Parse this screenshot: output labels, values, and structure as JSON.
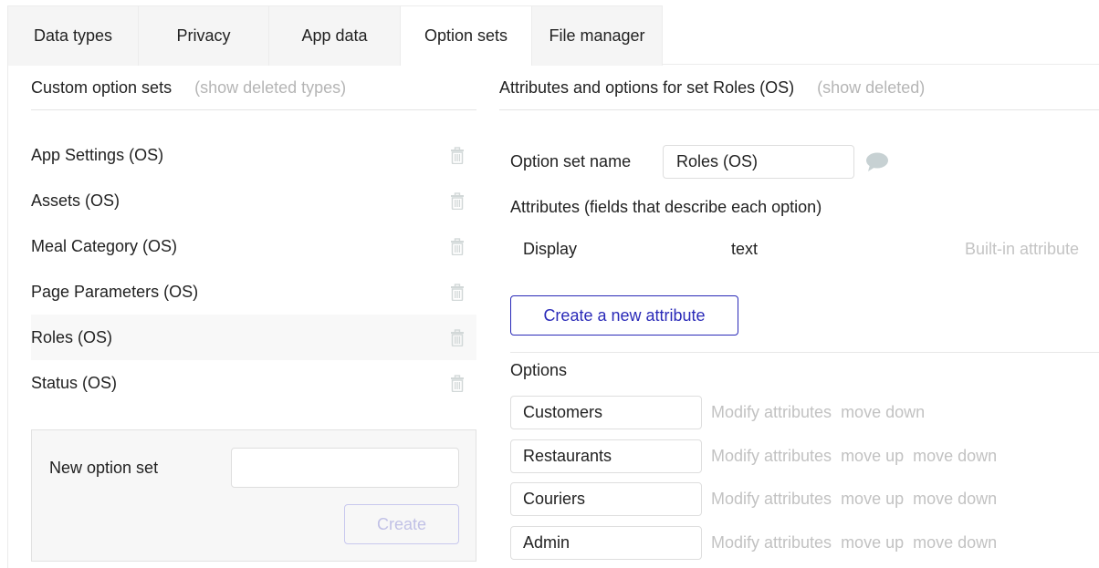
{
  "tabs": [
    {
      "label": "Data types",
      "active": false
    },
    {
      "label": "Privacy",
      "active": false
    },
    {
      "label": "App data",
      "active": false
    },
    {
      "label": "Option sets",
      "active": true
    },
    {
      "label": "File manager",
      "active": false
    }
  ],
  "left_panel": {
    "title": "Custom option sets",
    "show_deleted_link": "(show deleted types)",
    "option_sets": [
      {
        "name": "App Settings (OS)",
        "selected": false
      },
      {
        "name": "Assets (OS)",
        "selected": false
      },
      {
        "name": "Meal Category (OS)",
        "selected": false
      },
      {
        "name": "Page Parameters (OS)",
        "selected": false
      },
      {
        "name": "Roles (OS)",
        "selected": true
      },
      {
        "name": "Status (OS)",
        "selected": false
      }
    ],
    "delete_icon": "trash-icon",
    "new_set": {
      "label": "New option set",
      "input_value": "",
      "create_label": "Create"
    }
  },
  "right_panel": {
    "title": "Attributes and options for set Roles (OS)",
    "show_deleted_link": "(show deleted)",
    "name_label": "Option set name",
    "name_value": "Roles (OS)",
    "comment_icon": "speech-bubble-icon",
    "attributes_heading": "Attributes (fields that describe each option)",
    "attributes": [
      {
        "name": "Display",
        "type": "text",
        "note": "Built-in attribute"
      }
    ],
    "new_attribute_label": "Create a new attribute",
    "options_heading": "Options",
    "modify_label": "Modify attributes",
    "move_up_label": "move up",
    "move_down_label": "move down",
    "options": [
      {
        "value": "Customers",
        "can_move_up": false,
        "can_move_down": true
      },
      {
        "value": "Restaurants",
        "can_move_up": true,
        "can_move_down": true
      },
      {
        "value": "Couriers",
        "can_move_up": true,
        "can_move_down": true
      },
      {
        "value": "Admin",
        "can_move_up": true,
        "can_move_down": true
      }
    ]
  },
  "colors": {
    "accent": "#2a2ab8",
    "muted_text": "#b5b5b5",
    "tab_inactive_bg": "#f5f5f5",
    "selected_row_bg": "#f8f8f8"
  }
}
